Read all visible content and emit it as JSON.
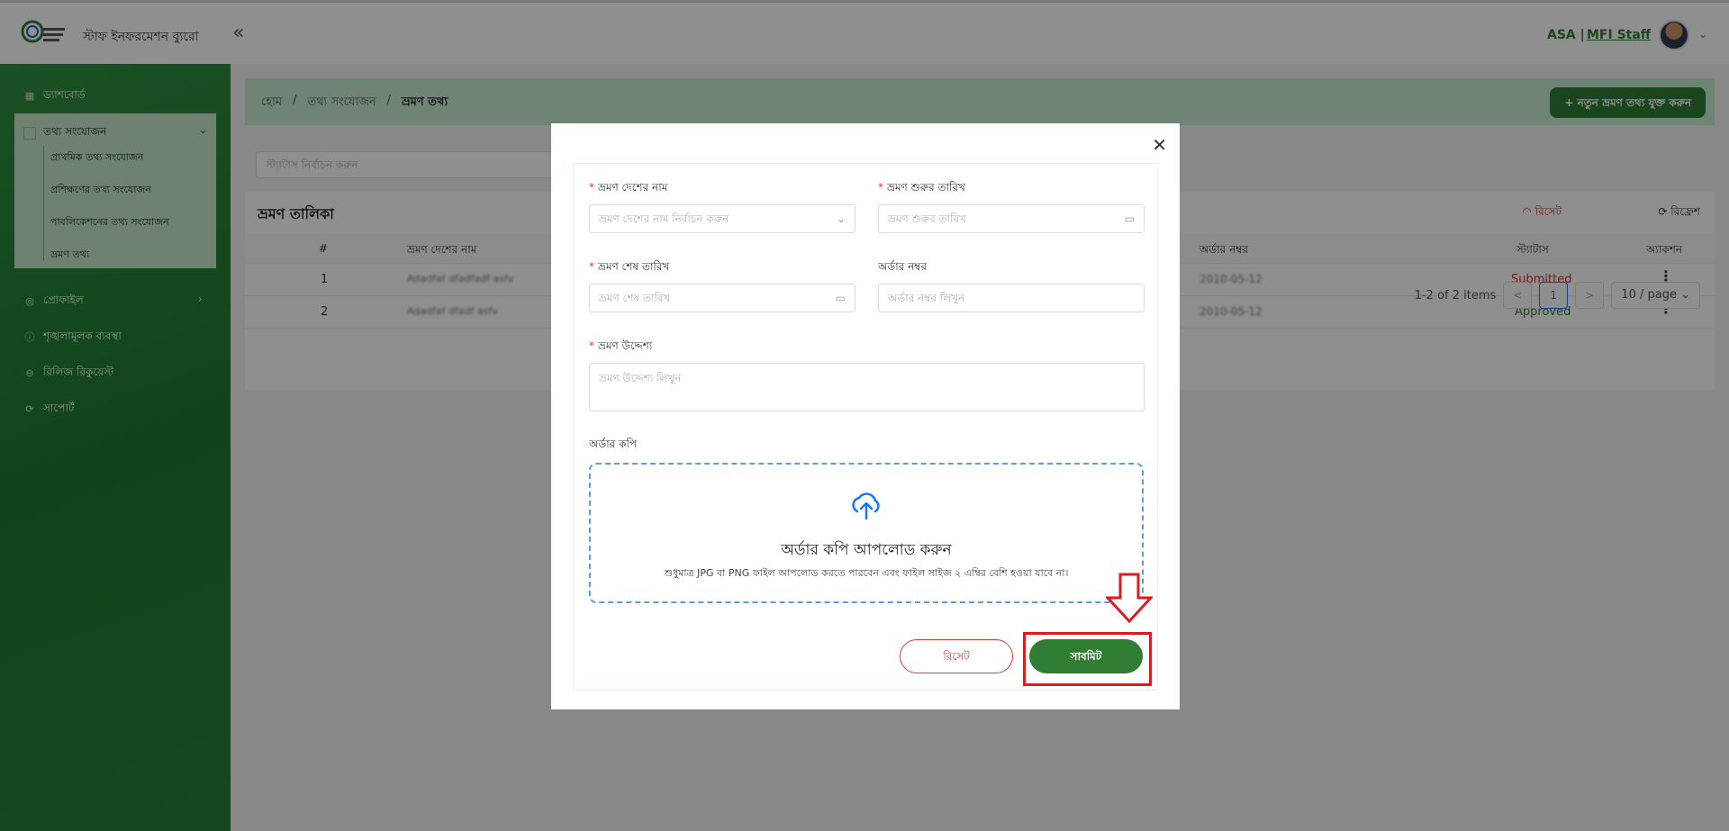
{
  "header": {
    "app_title": "স্টাফ ইনফরমেশন ব্যুরো",
    "collapse_icon": "«",
    "user_org": "ASA |",
    "user_role": "MFI Staff"
  },
  "sidebar": {
    "dashboard": "ড্যাশবোর্ড",
    "data_entry": "তথ্য সংযোজন",
    "sub_items": [
      "প্রাথমিক তথ্য সংযোজন",
      "প্রশিক্ষণের তথ্য সংযোজন",
      "পাবলিকেশনের তথ্য সংযোজন",
      "ভ্রমণ তথ্য"
    ],
    "profile": "প্রোফাইল",
    "discipline": "শৃঙ্খলামূলক ব্যবস্থা",
    "release_request": "রিলিজ রিকুয়েস্ট",
    "support": "সাপোর্ট"
  },
  "breadcrumb": {
    "home": "হোম",
    "sep": "/",
    "section": "তথ্য সংযোজন",
    "current": "ভ্রমণ তথ্য"
  },
  "add_button": "+ নতুন ভ্রমণ তথ্য যুক্ত করুন",
  "filter": {
    "status_placeholder": "স্ট্যাটাস নির্বাচন করুন"
  },
  "table": {
    "title": "ভ্রমণ তালিকা",
    "reset": "রিসেট",
    "refresh": "রিফ্রেশ",
    "headers": {
      "index": "#",
      "country": "ভ্রমণ দেশের নাম",
      "order_no": "অর্ডার নম্বর",
      "status": "স্ট্যাটাস",
      "action": "অ্যাকশন"
    },
    "rows": [
      {
        "index": "1",
        "country": "Adadfaf dfadfadf asfv",
        "order_no": "2010-05-12",
        "status": "Submitted"
      },
      {
        "index": "2",
        "country": "Adadfaf dfadf asfv",
        "order_no": "2010-05-12",
        "status": "Approved"
      }
    ],
    "pagination": {
      "summary": "1-2 of 2 items",
      "prev": "<",
      "current": "1",
      "next": ">",
      "page_size": "10 / page"
    }
  },
  "modal": {
    "country_label": "ভ্রমণ দেশের নাম",
    "country_placeholder": "ভ্রমণ দেশের নাম নির্বাচন করুন",
    "start_label": "ভ্রমণ শুরুর তারিখ",
    "start_placeholder": "ভ্রমণ শুরুর তারিখ",
    "end_label": "ভ্রমণ শেষ তারিখ",
    "end_placeholder": "ভ্রমণ শেষ তারিখ",
    "order_label": "অর্ডার নম্বর",
    "order_placeholder": "অর্ডার নম্বর লিখুন",
    "purpose_label": "ভ্রমণ উদ্দেশ্য",
    "purpose_placeholder": "ভ্রমণ উদ্দেশ্য লিখুন",
    "copy_label": "অর্ডার কপি",
    "upload_title": "অর্ডার কপি আপলোড করুন",
    "upload_hint": "শুধুমাত্র JPG বা PNG ফাইল আপলোড করতে পারবেন এবং ফাইল সাইজ ২ এম্বির বেশি হওয়া যাবে না।",
    "reset_button": "রিসেট",
    "submit_button": "সাবমিট"
  },
  "colors": {
    "primary_green": "#2e7d32",
    "danger_red": "#e53935",
    "highlight_red": "#e0191f",
    "upload_blue": "#5b9be8"
  }
}
